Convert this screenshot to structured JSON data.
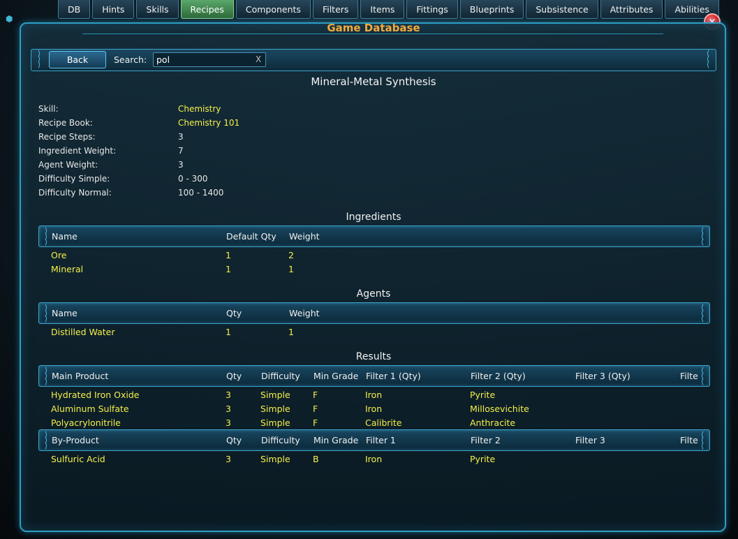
{
  "tabs": [
    "DB",
    "Hints",
    "Skills",
    "Recipes",
    "Components",
    "Filters",
    "Items",
    "Fittings",
    "Blueprints",
    "Subsistence",
    "Attributes",
    "Abilities"
  ],
  "active_tab": "Recipes",
  "window_title": "Game Database",
  "close_label": "×",
  "search": {
    "back_label": "Back",
    "label": "Search:",
    "value": "pol",
    "clear_label": "X"
  },
  "recipe": {
    "name": "Mineral-Metal Synthesis",
    "props": [
      {
        "label": "Skill:",
        "value": "Chemistry"
      },
      {
        "label": "Recipe Book:",
        "value": "Chemistry 101"
      },
      {
        "label": "Recipe Steps:",
        "value": "3"
      },
      {
        "label": "Ingredient Weight:",
        "value": "7"
      },
      {
        "label": "Agent Weight:",
        "value": "3"
      },
      {
        "label": "Difficulty Simple:",
        "value": "0 - 300"
      },
      {
        "label": "Difficulty Normal:",
        "value": "100 - 1400"
      }
    ]
  },
  "ingredients": {
    "title": "Ingredients",
    "headers": [
      "Name",
      "Default Qty",
      "Weight"
    ],
    "rows": [
      [
        "Ore",
        "1",
        "2"
      ],
      [
        "Mineral",
        "1",
        "1"
      ]
    ]
  },
  "agents": {
    "title": "Agents",
    "headers": [
      "Name",
      "Qty",
      "Weight"
    ],
    "rows": [
      [
        "Distilled Water",
        "1",
        "1"
      ]
    ]
  },
  "results": {
    "title": "Results",
    "headers": [
      "Main Product",
      "Qty",
      "Difficulty",
      "Min Grade",
      "Filter 1 (Qty)",
      "Filter 2 (Qty)",
      "Filter 3 (Qty)",
      "Filte"
    ],
    "rows": [
      [
        "Hydrated Iron Oxide",
        "3",
        "Simple",
        "F",
        "Iron",
        "Pyrite"
      ],
      [
        "Aluminum Sulfate",
        "3",
        "Simple",
        "F",
        "Iron",
        "Millosevichite"
      ],
      [
        "Polyacrylonitrile",
        "3",
        "Simple",
        "F",
        "Calibrite",
        "Anthracite"
      ]
    ]
  },
  "byproducts": {
    "headers": [
      "By-Product",
      "Qty",
      "Difficulty",
      "Min Grade",
      "Filter 1",
      "Filter 2",
      "Filter 3",
      "Filte"
    ],
    "rows": [
      [
        "Sulfuric Acid",
        "3",
        "Simple",
        "B",
        "Iron",
        "Pyrite"
      ]
    ]
  },
  "colors": {
    "accent": "#f2a93b",
    "value_yellow": "#f5f04a",
    "frame": "#2e9ec4",
    "active_tab": "#4a9a5a",
    "close": "#d61e1e"
  }
}
